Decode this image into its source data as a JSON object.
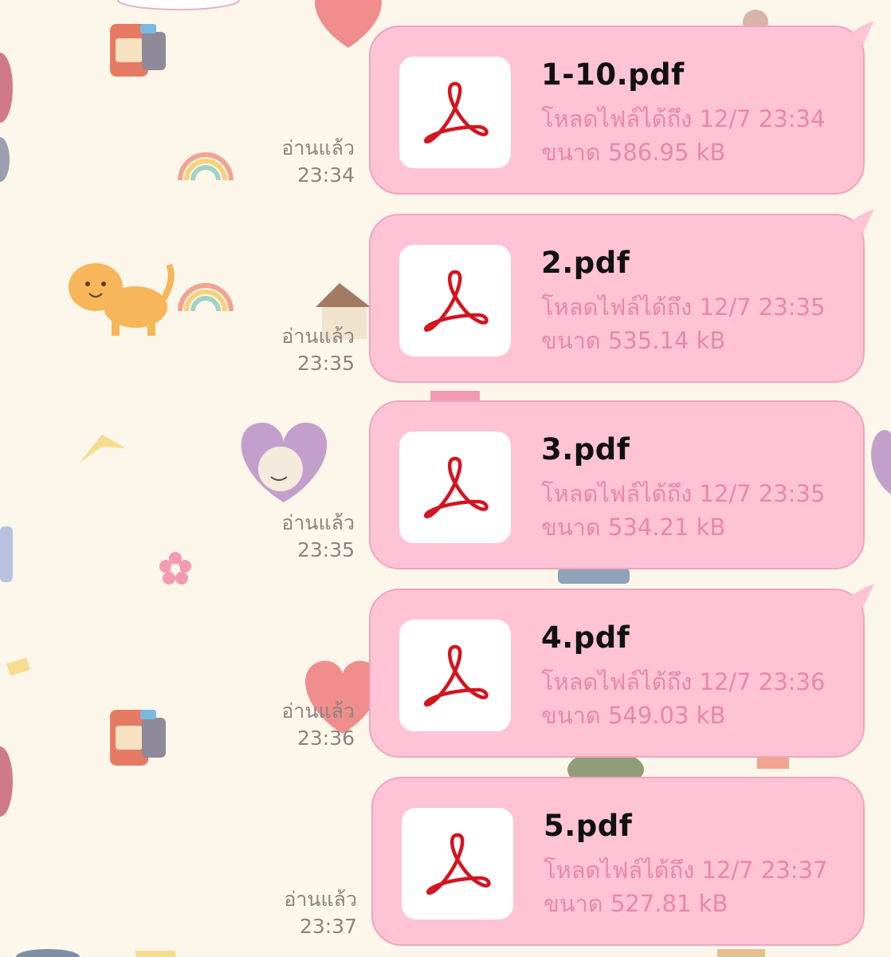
{
  "theme": {
    "bubble_color": "#ffc3d6",
    "bubble_border": "#f0a4bd",
    "meta_text_color": "#e889a4",
    "read_text_color": "#8b8580",
    "pdf_icon_color": "#d4141e"
  },
  "messages": [
    {
      "file_name": "1-10.pdf",
      "expiry_label": "โหลดไฟล์ได้ถึง",
      "expiry_value": "12/7 23:34",
      "size_label": "ขนาด",
      "size_value": "586.95 kB",
      "read_label": "อ่านแล้ว",
      "time": "23:34",
      "icon": "pdf-icon"
    },
    {
      "file_name": "2.pdf",
      "expiry_label": "โหลดไฟล์ได้ถึง",
      "expiry_value": "12/7 23:35",
      "size_label": "ขนาด",
      "size_value": "535.14 kB",
      "read_label": "อ่านแล้ว",
      "time": "23:35",
      "icon": "pdf-icon"
    },
    {
      "file_name": "3.pdf",
      "expiry_label": "โหลดไฟล์ได้ถึง",
      "expiry_value": "12/7 23:35",
      "size_label": "ขนาด",
      "size_value": "534.21 kB",
      "read_label": "อ่านแล้ว",
      "time": "23:35",
      "icon": "pdf-icon"
    },
    {
      "file_name": "4.pdf",
      "expiry_label": "โหลดไฟล์ได้ถึง",
      "expiry_value": "12/7 23:36",
      "size_label": "ขนาด",
      "size_value": "549.03 kB",
      "read_label": "อ่านแล้ว",
      "time": "23:36",
      "icon": "pdf-icon"
    },
    {
      "file_name": "5.pdf",
      "expiry_label": "โหลดไฟล์ได้ถึง",
      "expiry_value": "12/7 23:37",
      "size_label": "ขนาด",
      "size_value": "527.81 kB",
      "read_label": "อ่านแล้ว",
      "time": "23:37",
      "icon": "pdf-icon"
    }
  ]
}
